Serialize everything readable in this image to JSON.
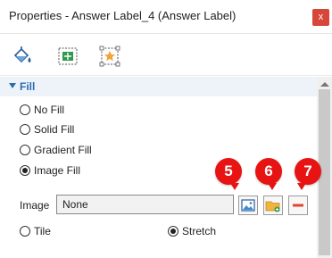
{
  "window": {
    "title": "Properties - Answer Label_4 (Answer Label)",
    "close_symbol": "x"
  },
  "toolbar": {
    "icons": [
      "paint-bucket-icon",
      "layout-move-icon",
      "star-frame-icon"
    ]
  },
  "fill": {
    "section_label": "Fill",
    "options": [
      {
        "label": "No Fill",
        "checked": false
      },
      {
        "label": "Solid Fill",
        "checked": false
      },
      {
        "label": "Gradient Fill",
        "checked": false
      },
      {
        "label": "Image Fill",
        "checked": true
      }
    ],
    "image_label": "Image",
    "image_value": "None",
    "mode_options": [
      {
        "label": "Tile",
        "checked": false
      },
      {
        "label": "Stretch",
        "checked": true
      }
    ]
  },
  "callouts": [
    "5",
    "6",
    "7"
  ],
  "colors": {
    "accent": "#2b6cb0",
    "callout": "#e81313",
    "close": "#d7463a",
    "header_bg": "#eef3f9"
  }
}
